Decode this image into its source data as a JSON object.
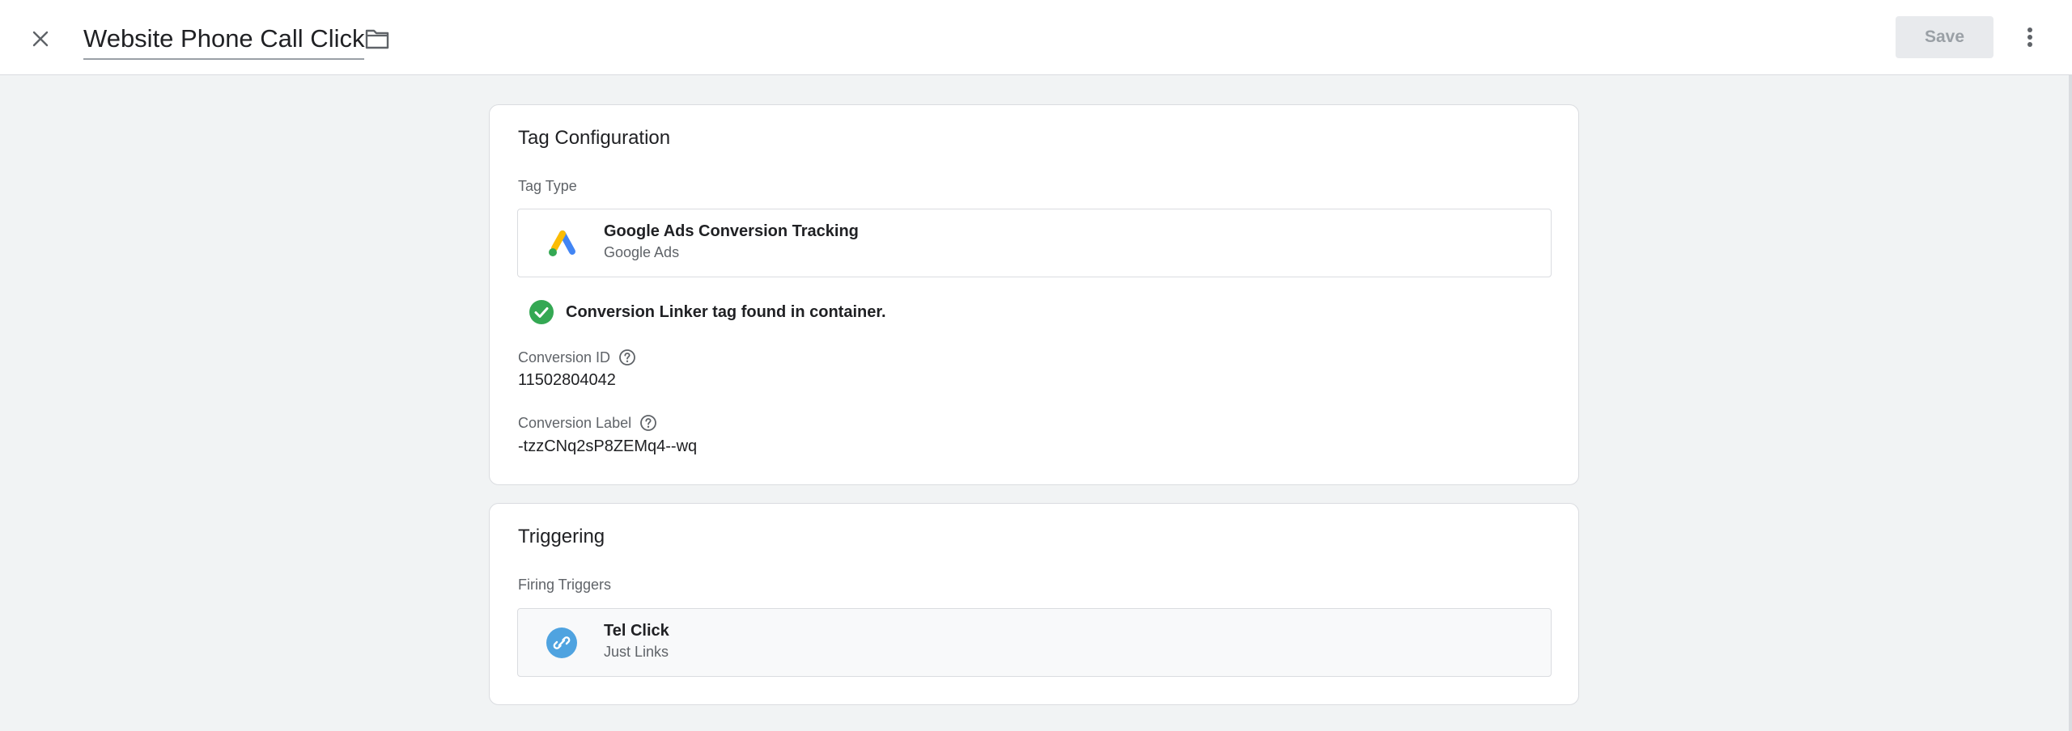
{
  "header": {
    "title": "Website Phone Call Click",
    "save_label": "Save"
  },
  "tag_config": {
    "title": "Tag Configuration",
    "tag_type_label": "Tag Type",
    "tag_type_name": "Google Ads Conversion Tracking",
    "tag_type_sub": "Google Ads",
    "linker_status": "Conversion Linker tag found in container.",
    "conversion_id_label": "Conversion ID",
    "conversion_id_value": "11502804042",
    "conversion_label_label": "Conversion Label",
    "conversion_label_value": "-tzzCNq2sP8ZEMq4--wq"
  },
  "triggering": {
    "title": "Triggering",
    "firing_label": "Firing Triggers",
    "trigger_name": "Tel Click",
    "trigger_sub": "Just Links"
  },
  "icons": {
    "close": "close-icon",
    "folder": "folder-icon",
    "more": "more-vert-icon",
    "ads": "google-ads-logo-icon",
    "check": "check-circle-icon",
    "help": "help-outline-icon",
    "link": "link-icon"
  },
  "colors": {
    "check_green": "#34a853",
    "link_blue": "#4fa3e0",
    "ads_blue": "#4285f4",
    "ads_yellow": "#fbbc04",
    "ads_green": "#34a853"
  }
}
